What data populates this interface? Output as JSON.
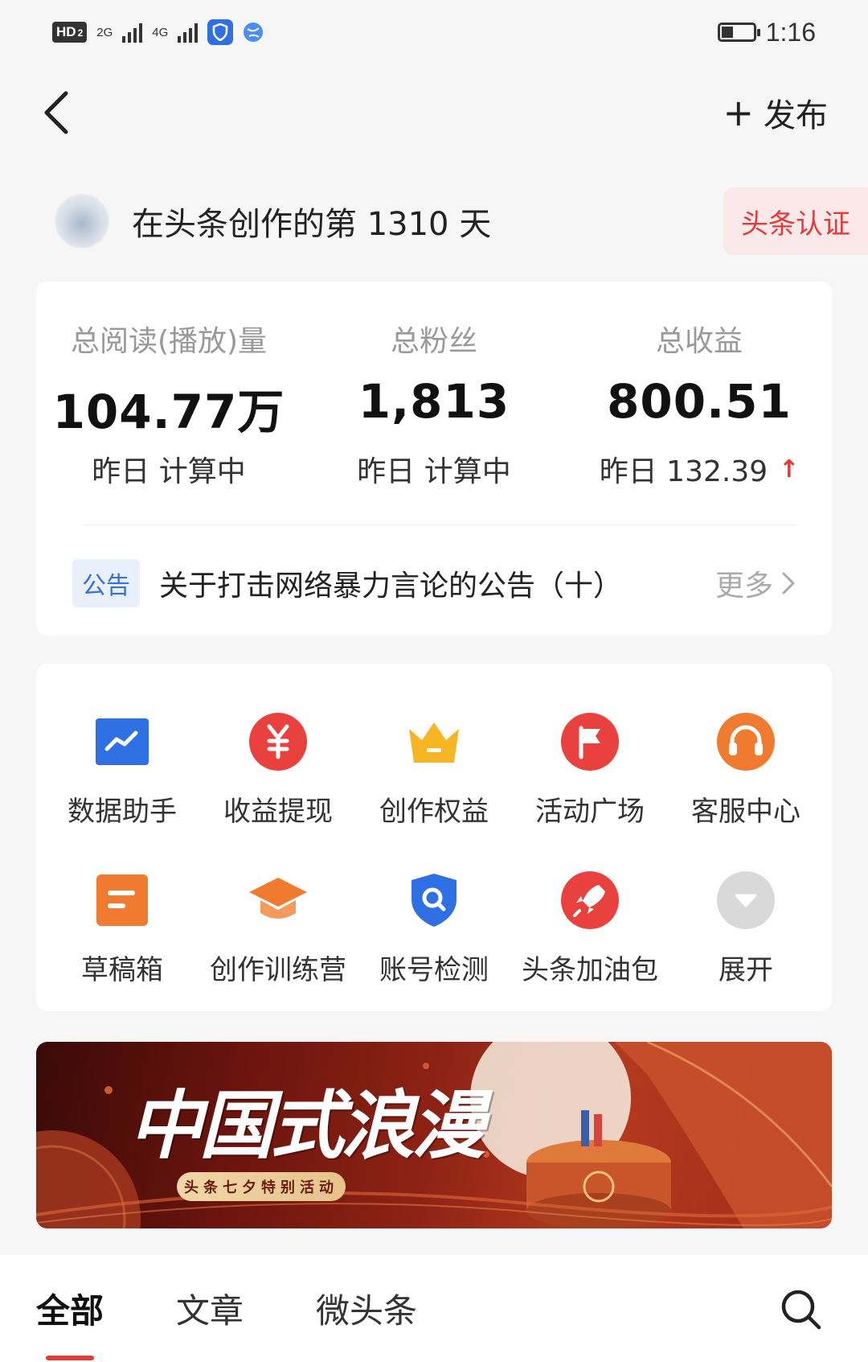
{
  "status_bar": {
    "hd_label": "HD",
    "sim_index": "2",
    "net1": "2G",
    "net2": "4G",
    "time": "1:16"
  },
  "header": {
    "publish_label": "发布"
  },
  "creator": {
    "days_text": "在头条创作的第 1310 天",
    "cert_label": "头条认证"
  },
  "stats": [
    {
      "label": "总阅读(播放)量",
      "value": "104.77万",
      "sub": "昨日 计算中"
    },
    {
      "label": "总粉丝",
      "value": "1,813",
      "sub": "昨日 计算中"
    },
    {
      "label": "总收益",
      "value": "800.51",
      "sub": "昨日 132.39"
    }
  ],
  "notice": {
    "tag": "公告",
    "text": "关于打击网络暴力言论的公告（十）",
    "more": "更多"
  },
  "tools": [
    {
      "label": "数据助手",
      "icon": "chart-icon",
      "color": "#2f6fe4"
    },
    {
      "label": "收益提现",
      "icon": "yuan-icon",
      "color": "#e8413e"
    },
    {
      "label": "创作权益",
      "icon": "crown-icon",
      "color": "#f6b522"
    },
    {
      "label": "活动广场",
      "icon": "flag-icon",
      "color": "#e8413e"
    },
    {
      "label": "客服中心",
      "icon": "headset-icon",
      "color": "#f07a2f"
    },
    {
      "label": "草稿箱",
      "icon": "draft-icon",
      "color": "#f07a2f"
    },
    {
      "label": "创作训练营",
      "icon": "graduation-cap-icon",
      "color": "#f07a2f"
    },
    {
      "label": "账号检测",
      "icon": "shield-search-icon",
      "color": "#2f6fe4"
    },
    {
      "label": "头条加油包",
      "icon": "rocket-icon",
      "color": "#e8413e"
    },
    {
      "label": "展开",
      "icon": "expand-icon",
      "color": "#cccccc"
    }
  ],
  "banner": {
    "title": "中国式浪漫",
    "subtitle": "头条七夕特别活动"
  },
  "tabs": [
    {
      "label": "全部",
      "active": true
    },
    {
      "label": "文章",
      "active": false
    },
    {
      "label": "微头条",
      "active": false
    }
  ],
  "colors": {
    "accent_red": "#e23b3b",
    "notice_blue": "#3b6fd8",
    "background": "#f6f6f7"
  }
}
